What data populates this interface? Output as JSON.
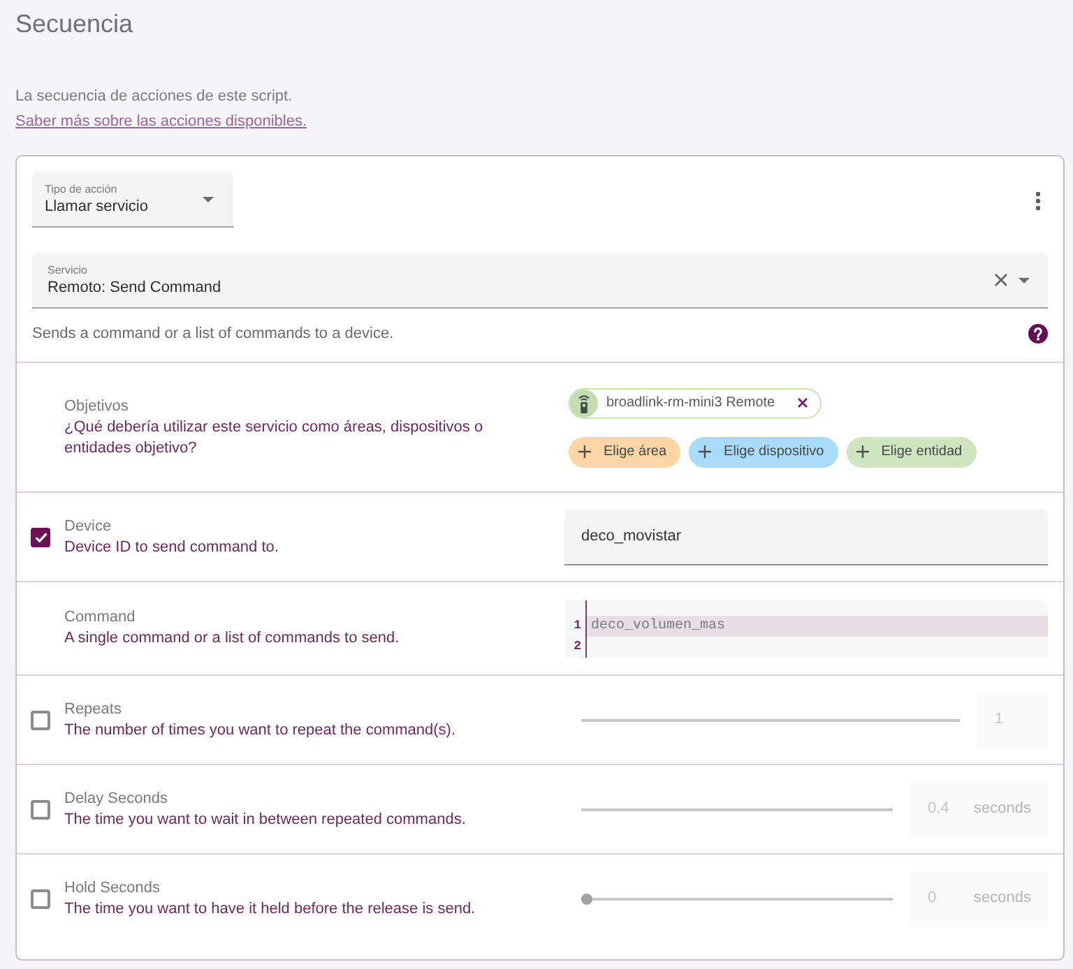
{
  "header": {
    "title": "Secuencia",
    "description": "La secuencia de acciones de este script.",
    "link": "Saber más sobre las acciones disponibles."
  },
  "action": {
    "type_select": {
      "label": "Tipo de acción",
      "value": "Llamar servicio"
    },
    "service_select": {
      "label": "Servicio",
      "value": "Remoto: Send Command"
    },
    "service_description": "Sends a command or a list of commands to a device."
  },
  "fields": [
    {
      "kind": "targets",
      "name": "Objetivos",
      "description": "¿Qué debería utilizar este servicio como áreas, dispositivos o entidades objetivo?",
      "chips": [
        {
          "label": "broadlink-rm-mini3 Remote"
        }
      ],
      "pickers": [
        {
          "label": "Elige área",
          "color": "#fdd6a5"
        },
        {
          "label": "Elige dispositivo",
          "color": "#a8dcf8"
        },
        {
          "label": "Elige entidad",
          "color": "#cfe5c1"
        }
      ]
    },
    {
      "kind": "text",
      "name": "Device",
      "description": "Device ID to send command to.",
      "checked": true,
      "value": "deco_movistar"
    },
    {
      "kind": "code",
      "name": "Command",
      "description": "A single command or a list of commands to send.",
      "lines": [
        {
          "number": "1",
          "text": "deco_volumen_mas",
          "active": true
        },
        {
          "number": "2",
          "active": false
        }
      ]
    },
    {
      "kind": "slider",
      "name": "Repeats",
      "description": "The number of times you want to repeat the command(s).",
      "checked": false,
      "value": "1"
    },
    {
      "kind": "slider",
      "name": "Delay Seconds",
      "description": "The time you want to wait in between repeated commands.",
      "checked": false,
      "value": "0,4",
      "unit": "seconds"
    },
    {
      "kind": "slider",
      "name": "Hold Seconds",
      "description": "The time you want to have it held before the release is send.",
      "checked": false,
      "value": "0",
      "unit": "seconds",
      "level": 0
    }
  ]
}
